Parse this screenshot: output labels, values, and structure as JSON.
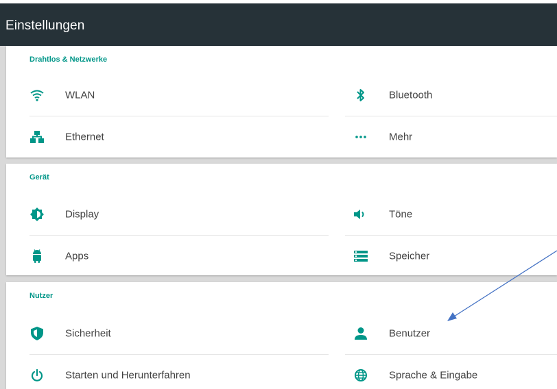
{
  "appbar": {
    "title": "Einstellungen"
  },
  "colors": {
    "accent": "#009688",
    "appbar": "#263238",
    "arrow": "#4472c4"
  },
  "sections": [
    {
      "header": "Drahtlos & Netzwerke",
      "items": [
        {
          "label": "WLAN",
          "icon": "wifi-icon"
        },
        {
          "label": "Bluetooth",
          "icon": "bluetooth-icon"
        },
        {
          "label": "Ethernet",
          "icon": "ethernet-icon"
        },
        {
          "label": "Mehr",
          "icon": "more-icon"
        }
      ]
    },
    {
      "header": "Gerät",
      "items": [
        {
          "label": "Display",
          "icon": "brightness-icon"
        },
        {
          "label": "Töne",
          "icon": "volume-icon"
        },
        {
          "label": "Apps",
          "icon": "android-icon"
        },
        {
          "label": "Speicher",
          "icon": "storage-icon"
        }
      ]
    },
    {
      "header": "Nutzer",
      "items": [
        {
          "label": "Sicherheit",
          "icon": "shield-icon"
        },
        {
          "label": "Benutzer",
          "icon": "person-icon"
        },
        {
          "label": "Starten und Herunterfahren",
          "icon": "power-icon"
        },
        {
          "label": "Sprache & Eingabe",
          "icon": "globe-icon"
        }
      ]
    }
  ]
}
